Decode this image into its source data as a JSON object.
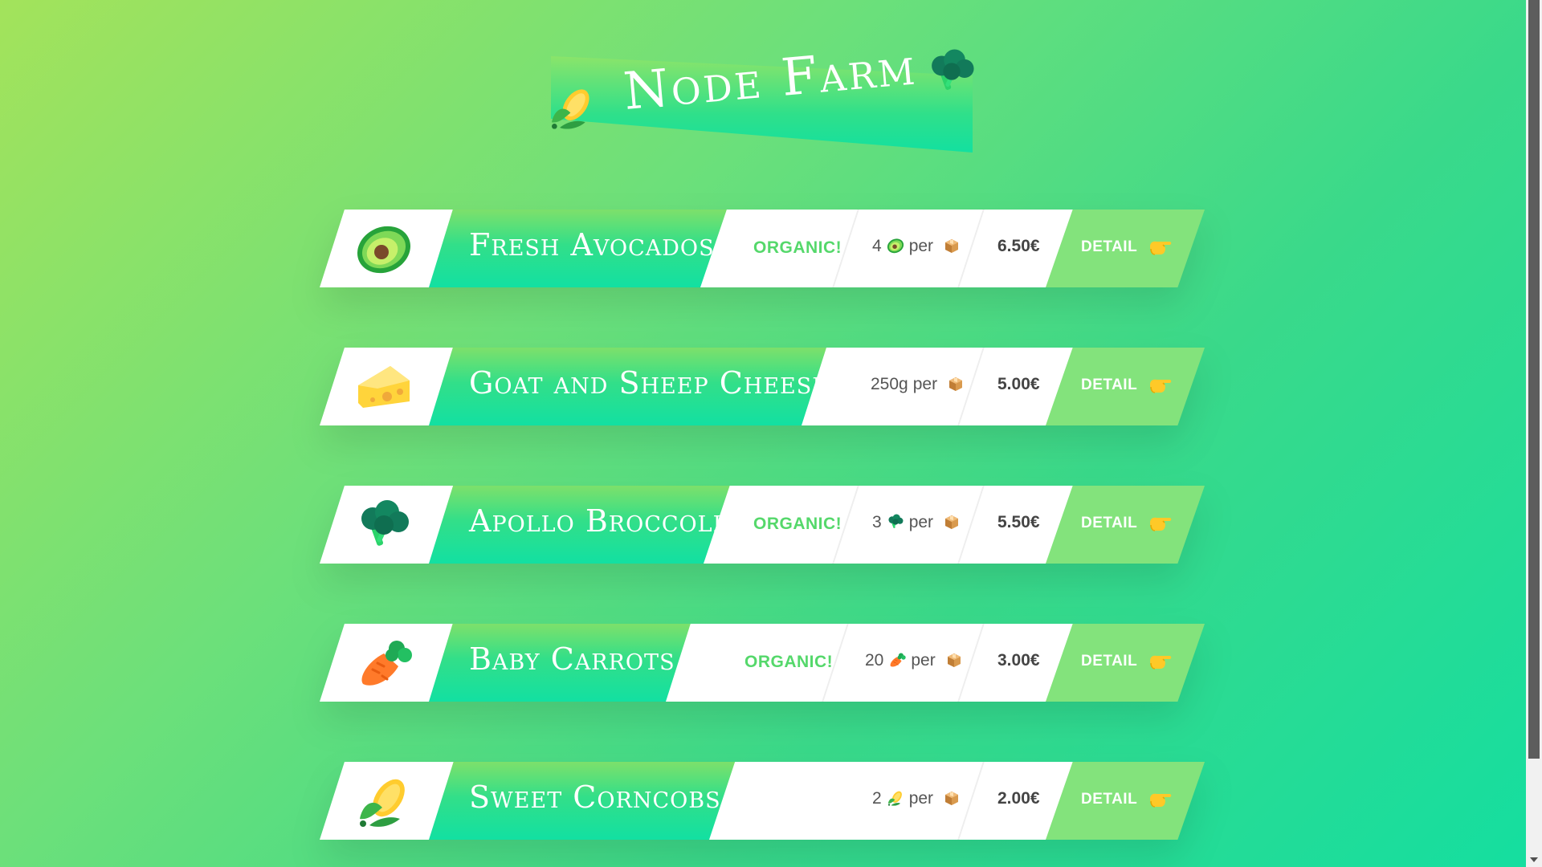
{
  "header": {
    "title": "Node Farm",
    "left_icon": "corn-icon",
    "right_icon": "broccoli-icon"
  },
  "colors": {
    "accent_green": "#55d86b",
    "detail_green": "#83e37c",
    "name_gradient_top": "#7de06b",
    "name_gradient_bottom": "#12e0a2"
  },
  "products": [
    {
      "icon": "avocado-icon",
      "name": "Fresh Avocados",
      "organic": "ORGANIC!",
      "quantity": "4",
      "unit_icon": "avocado-icon",
      "per": "per",
      "package_icon": "package-icon",
      "price": "6.50€",
      "detail": "DETAIL",
      "detail_icon": "pointing-hand-icon"
    },
    {
      "icon": "cheese-icon",
      "name": "Goat and Sheep Cheese",
      "organic": "",
      "quantity": "250g",
      "unit_icon": "",
      "per": "per",
      "package_icon": "package-icon",
      "price": "5.00€",
      "detail": "DETAIL",
      "detail_icon": "pointing-hand-icon"
    },
    {
      "icon": "broccoli-icon",
      "name": "Apollo Broccoli",
      "organic": "ORGANIC!",
      "quantity": "3",
      "unit_icon": "broccoli-icon",
      "per": "per",
      "package_icon": "package-icon",
      "price": "5.50€",
      "detail": "DETAIL",
      "detail_icon": "pointing-hand-icon"
    },
    {
      "icon": "carrot-icon",
      "name": "Baby Carrots",
      "organic": "ORGANIC!",
      "quantity": "20",
      "unit_icon": "carrot-icon",
      "per": "per",
      "package_icon": "package-icon",
      "price": "3.00€",
      "detail": "DETAIL",
      "detail_icon": "pointing-hand-icon"
    },
    {
      "icon": "corn-icon",
      "name": "Sweet Corncobs",
      "organic": "",
      "quantity": "2",
      "unit_icon": "corn-icon",
      "per": "per",
      "package_icon": "package-icon",
      "price": "2.00€",
      "detail": "DETAIL",
      "detail_icon": "pointing-hand-icon"
    }
  ]
}
